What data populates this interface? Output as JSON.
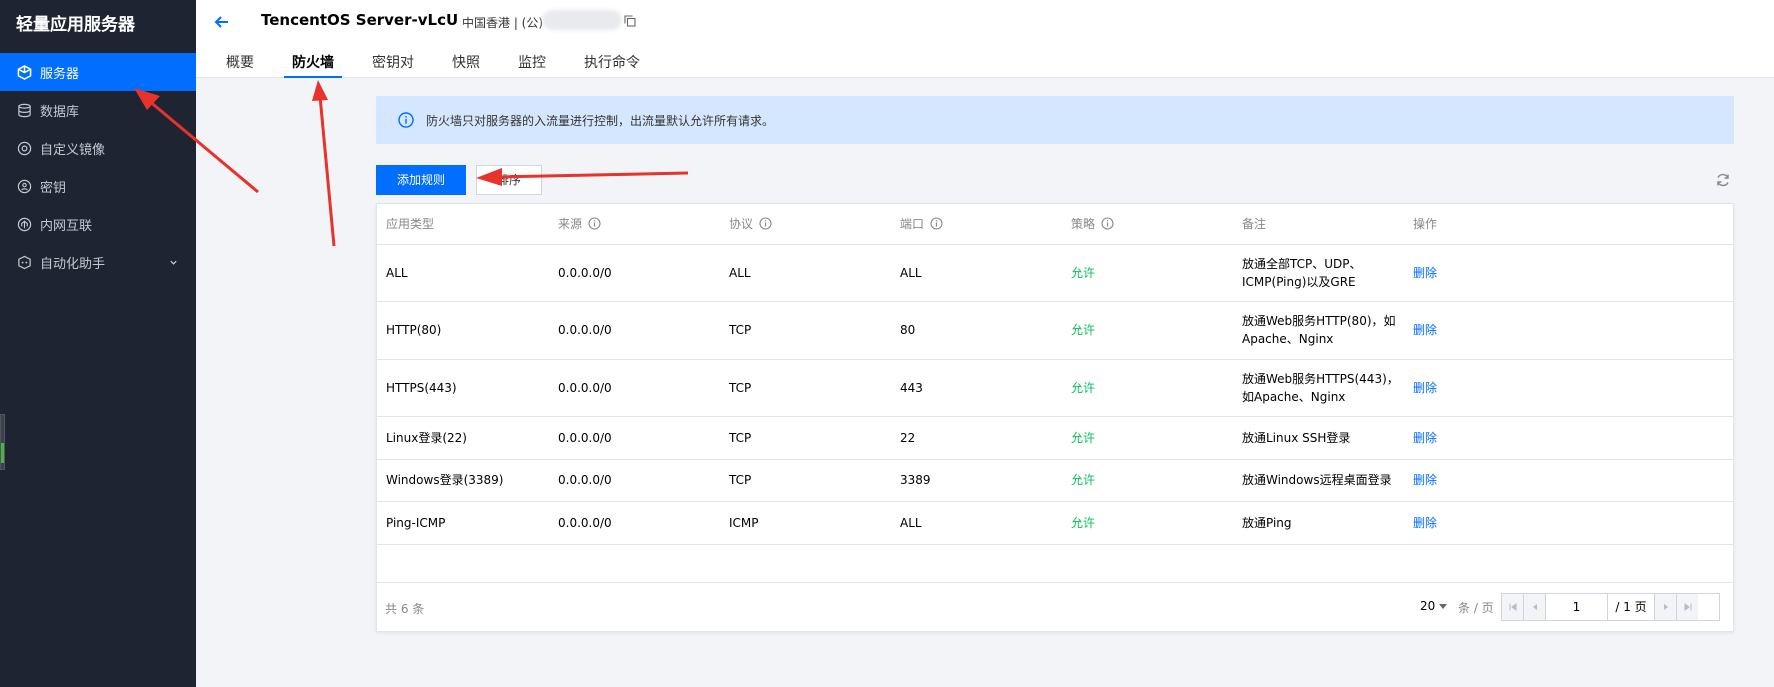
{
  "sidebar": {
    "title": "轻量应用服务器",
    "items": [
      {
        "label": "服务器",
        "icon": "cube-icon",
        "active": true
      },
      {
        "label": "数据库",
        "icon": "database-icon"
      },
      {
        "label": "自定义镜像",
        "icon": "disc-icon"
      },
      {
        "label": "密钥",
        "icon": "key-icon"
      },
      {
        "label": "内网互联",
        "icon": "network-icon"
      },
      {
        "label": "自动化助手",
        "icon": "robot-icon",
        "expandable": true
      }
    ]
  },
  "header": {
    "server_name": "TencentOS Server-vLcU",
    "region": "中国香港 | (公)"
  },
  "tabs": [
    {
      "label": "概要"
    },
    {
      "label": "防火墙",
      "active": true
    },
    {
      "label": "密钥对"
    },
    {
      "label": "快照"
    },
    {
      "label": "监控"
    },
    {
      "label": "执行命令"
    }
  ],
  "notice": "防火墙只对服务器的入流量进行控制，出流量默认允许所有请求。",
  "toolbar": {
    "add_label": "添加规则",
    "sort_label": "排序"
  },
  "table": {
    "columns": [
      "应用类型",
      "来源",
      "协议",
      "端口",
      "策略",
      "备注",
      "操作"
    ],
    "rows": [
      {
        "app": "ALL",
        "source": "0.0.0.0/0",
        "protocol": "ALL",
        "port": "ALL",
        "policy": "允许",
        "note": "放通全部TCP、UDP、ICMP(Ping)以及GRE",
        "action": "删除"
      },
      {
        "app": "HTTP(80)",
        "source": "0.0.0.0/0",
        "protocol": "TCP",
        "port": "80",
        "policy": "允许",
        "note": "放通Web服务HTTP(80)，如Apache、Nginx",
        "action": "删除"
      },
      {
        "app": "HTTPS(443)",
        "source": "0.0.0.0/0",
        "protocol": "TCP",
        "port": "443",
        "policy": "允许",
        "note": "放通Web服务HTTPS(443)，如Apache、Nginx",
        "action": "删除"
      },
      {
        "app": "Linux登录(22)",
        "source": "0.0.0.0/0",
        "protocol": "TCP",
        "port": "22",
        "policy": "允许",
        "note": "放通Linux SSH登录",
        "action": "删除"
      },
      {
        "app": "Windows登录(3389)",
        "source": "0.0.0.0/0",
        "protocol": "TCP",
        "port": "3389",
        "policy": "允许",
        "note": "放通Windows远程桌面登录",
        "action": "删除"
      },
      {
        "app": "Ping-ICMP",
        "source": "0.0.0.0/0",
        "protocol": "ICMP",
        "port": "ALL",
        "policy": "允许",
        "note": "放通Ping",
        "action": "删除"
      }
    ]
  },
  "pagination": {
    "total_text": "共 6 条",
    "page_size": "20",
    "per_page_text": "条 / 页",
    "current_page": "1",
    "total_pages_text": "/ 1 页"
  },
  "colors": {
    "accent": "#006eff",
    "allow": "#0abf5b",
    "sidebar_bg": "#1e2432",
    "annotation": "#e8322c"
  }
}
